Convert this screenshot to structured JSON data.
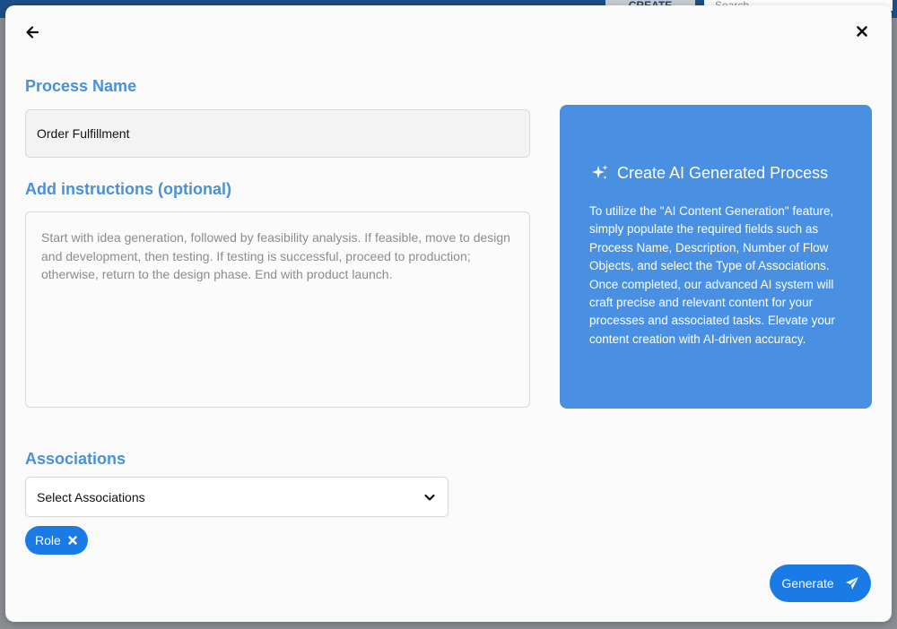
{
  "background": {
    "create_label": "CREATE",
    "search_placeholder": "Search"
  },
  "modal": {
    "process_name": {
      "label": "Process Name",
      "value": "Order Fulfillment"
    },
    "instructions": {
      "label": "Add instructions (optional)",
      "value": "Start with idea generation, followed by feasibility analysis. If feasible, move to design and development, then testing. If testing is successful, proceed to production; otherwise, return to the design phase. End with product launch."
    },
    "ai_panel": {
      "title": "Create AI Generated Process",
      "icon": "sparkles-icon",
      "description": "To utilize the \"AI Content Generation\" feature, simply populate the required fields such as Process Name, Description, Number of Flow Objects, and select the Type of Associations. Once completed, our advanced AI system will craft precise and relevant content for your processes and associated tasks. Elevate your content creation with AI-driven accuracy."
    },
    "associations": {
      "label": "Associations",
      "select_value": "Select Associations",
      "chips": [
        {
          "label": "Role"
        }
      ]
    },
    "generate_label": "Generate"
  },
  "colors": {
    "accent": "#4a90d9",
    "panel": "#4a90e2",
    "primary_button": "#1a7be6"
  }
}
